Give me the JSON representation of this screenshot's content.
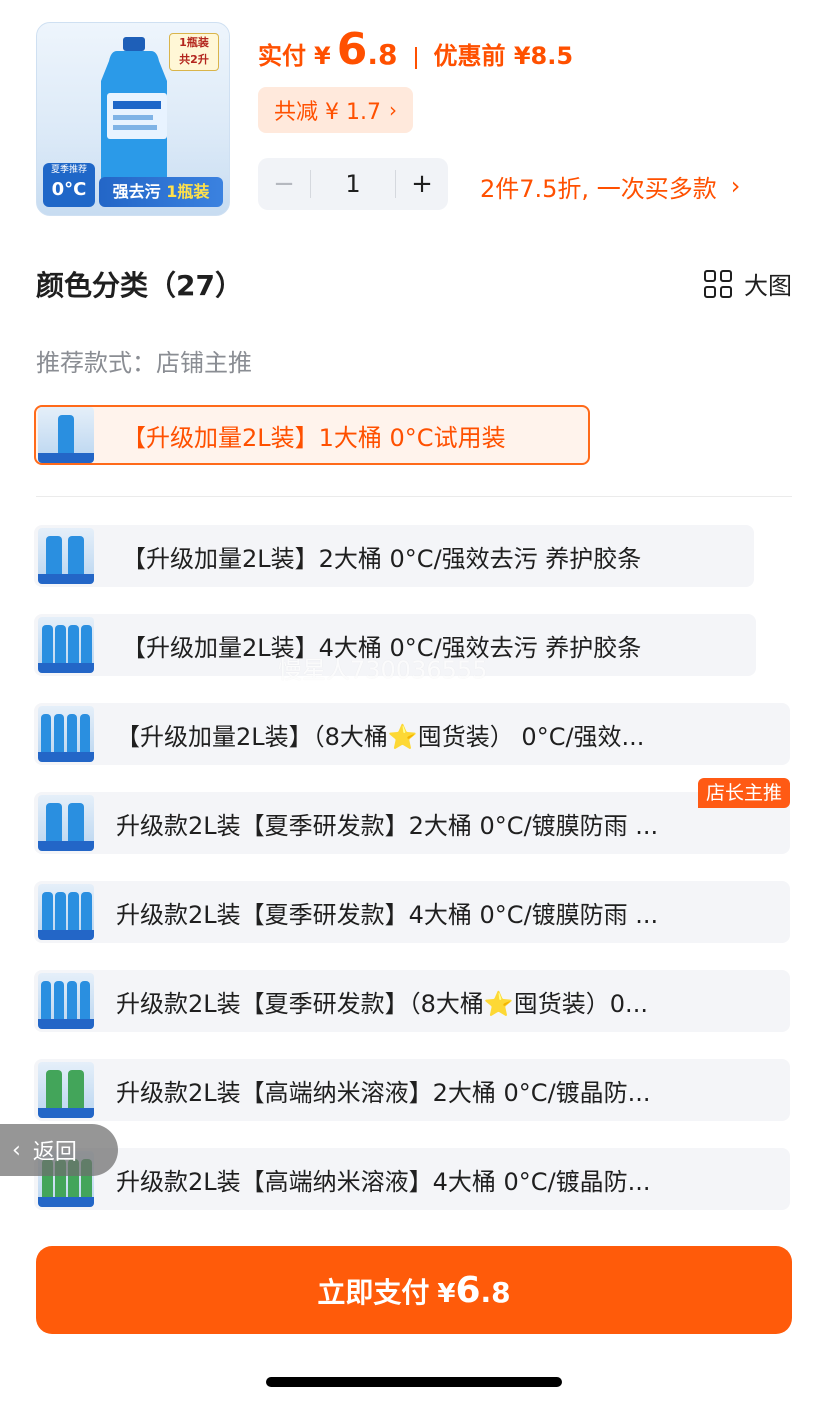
{
  "product": {
    "thumb": {
      "badge_line1": "1瓶装",
      "badge_line2": "共2升",
      "temp_small": "夏季推荐",
      "temp_big": "0°C",
      "slogan_main": "强去污",
      "slogan_accent": "1瓶装"
    },
    "price": {
      "label": "实付",
      "currency": "¥",
      "integer": "6",
      "decimal": ".8",
      "original_label": "优惠前",
      "original_value": "¥8.5"
    },
    "saving": {
      "text": "共减 ¥ 1.7",
      "chevron": "›"
    },
    "quantity": {
      "minus": "−",
      "value": "1",
      "plus": "+"
    },
    "promo": {
      "text": "2件7.5折, 一次买多款",
      "chevron": "›"
    }
  },
  "category": {
    "title": "颜色分类（27）",
    "big_picture_label": "大图",
    "recommend_label": "推荐款式：店铺主推",
    "selected": {
      "text": "【升级加量2L装】1大桶 0°C试用装",
      "thumb_icon": "bottle-thumbnail"
    },
    "options": [
      {
        "text": "【升级加量2L装】2大桶 0°C/强效去污 养护胶条",
        "bottles": 2,
        "color": "blue"
      },
      {
        "text": "【升级加量2L装】4大桶 0°C/强效去污 养护胶条",
        "bottles": 4,
        "color": "blue"
      },
      {
        "text": "【升级加量2L装】（8大桶⭐囤货装） 0°C/强效...",
        "bottles": 8,
        "color": "blue"
      },
      {
        "text": "升级款2L装【夏季研发款】2大桶 0°C/镀膜防雨 ...",
        "bottles": 2,
        "color": "blue",
        "tag": "店长主推"
      },
      {
        "text": "升级款2L装【夏季研发款】4大桶 0°C/镀膜防雨 ...",
        "bottles": 4,
        "color": "blue"
      },
      {
        "text": "升级款2L装【夏季研发款】（8大桶⭐囤货装）0...",
        "bottles": 8,
        "color": "blue"
      },
      {
        "text": "升级款2L装【高端纳米溶液】2大桶 0°C/镀晶防...",
        "bottles": 2,
        "color": "green"
      },
      {
        "text": "升级款2L装【高端纳米溶液】4大桶 0°C/镀晶防...",
        "bottles": 4,
        "color": "green"
      }
    ]
  },
  "watermark": "慢星人730036555",
  "back_button": {
    "label": "返回",
    "chevron": "‹"
  },
  "pay_button": {
    "label": "立即支付",
    "currency": "¥",
    "integer": "6",
    "decimal": ".8"
  },
  "colors": {
    "accent": "#ff5000",
    "pay_bg": "#ff5b0a",
    "option_bg": "#f4f5f8"
  }
}
